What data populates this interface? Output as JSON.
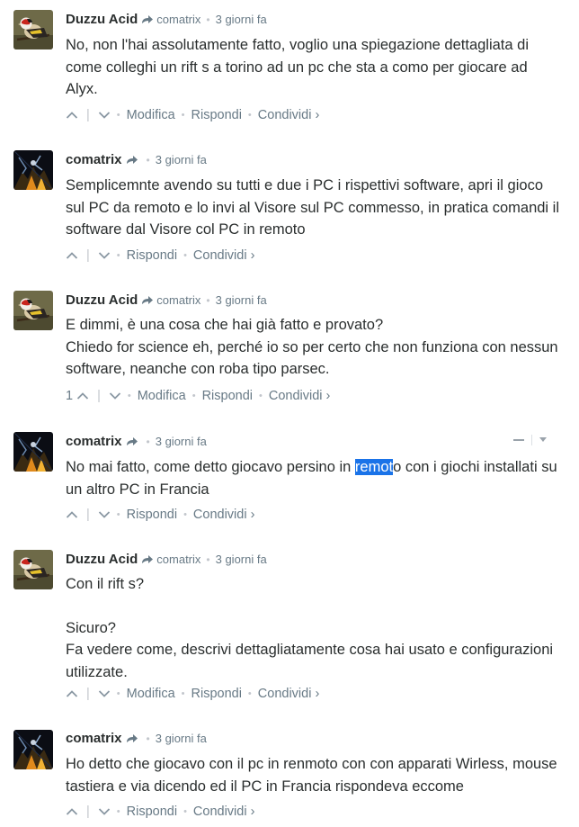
{
  "comments": [
    {
      "author": "Duzzu Acid",
      "reply_to": "comatrix",
      "time": "3 giorni fa",
      "avatar": "goldfinch",
      "body": [
        "No, non l'hai assolutamente fatto, voglio una spiegazione dettagliata di come colleghi un rift s a torino ad un pc che sta a como per giocare ad Alyx."
      ],
      "actions": {
        "edit": "Modifica",
        "reply": "Rispondi",
        "share": "Condividi ›"
      }
    },
    {
      "author": "comatrix",
      "time": "3 giorni fa",
      "avatar": "dark-art",
      "body": [
        "Semplicemnte avendo su tutti e due i PC i rispettivi software, apri il gioco sul PC da remoto e lo invi al Visore sul PC commesso, in pratica comandi il software dal Visore col PC in remoto"
      ],
      "actions": {
        "reply": "Rispondi",
        "share": "Condividi ›"
      }
    },
    {
      "author": "Duzzu Acid",
      "reply_to": "comatrix",
      "time": "3 giorni fa",
      "avatar": "goldfinch",
      "upvotes": "1",
      "body": [
        "E dimmi, è una cosa che hai già fatto e provato?",
        "Chiedo for science eh, perché io so per certo che non funziona con nessun software, neanche con roba tipo parsec."
      ],
      "actions": {
        "edit": "Modifica",
        "reply": "Rispondi",
        "share": "Condividi ›"
      }
    },
    {
      "author": "comatrix",
      "time": "3 giorni fa",
      "avatar": "dark-art",
      "body_parts": {
        "before": "No mai fatto, come detto giocavo persino in ",
        "selected": "remot",
        "after": "o con i giochi installati su un altro PC in Francia"
      },
      "actions": {
        "reply": "Rispondi",
        "share": "Condividi ›"
      }
    },
    {
      "author": "Duzzu Acid",
      "reply_to": "comatrix",
      "time": "3 giorni fa",
      "avatar": "goldfinch",
      "body": [
        "Con il rift s?",
        "Sicuro?",
        "Fa vedere come, descrivi dettagliatamente cosa hai usato e configurazioni utilizzate."
      ],
      "actions": {
        "edit": "Modifica",
        "reply": "Rispondi",
        "share": "Condividi ›"
      }
    },
    {
      "author": "comatrix",
      "time": "3 giorni fa",
      "avatar": "dark-art",
      "body": [
        "Ho detto che giocavo con il pc in renmoto con con apparati Wirless, mouse tastiera e via dicendo ed il PC in Francia rispondeva eccome"
      ],
      "actions": {
        "reply": "Rispondi",
        "share": "Condividi ›"
      }
    }
  ],
  "colors": {
    "text": "#2a2e2e",
    "meta": "#687a86",
    "selection": "#1a73e8"
  }
}
